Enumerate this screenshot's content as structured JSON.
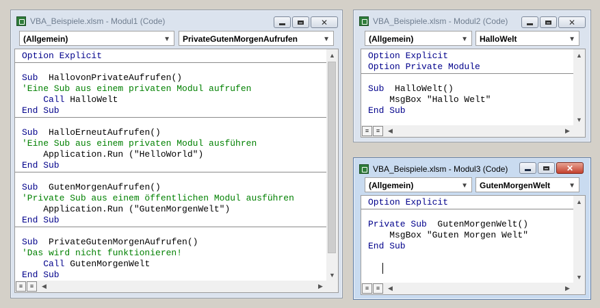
{
  "windows": [
    {
      "title": "VBA_Beispiele.xlsm - Modul1 (Code)",
      "object_combo": "(Allgemein)",
      "proc_combo": "PrivateGutenMorgenAufrufen",
      "lines": [
        "Option Explicit",
        "",
        "Sub HallovonPrivateAufrufen()",
        "'Eine Sub aus einem privaten Modul aufrufen",
        "    Call HalloWelt",
        "End Sub",
        "",
        "Sub HalloErneutAufrufen()",
        "'Eine Sub aus einem privaten Modul ausführen",
        "    Application.Run (\"HelloWorld\")",
        "End Sub",
        "",
        "Sub GutenMorgenAufrufen()",
        "'Private Sub aus einem öffentlichen Modul ausführen",
        "    Application.Run (\"GutenMorgenWelt\")",
        "End Sub",
        "",
        "Sub PrivateGutenMorgenAufrufen()",
        "'Das wird nicht funktionieren!",
        "    Call GutenMorgenWelt",
        "End Sub"
      ]
    },
    {
      "title": "VBA_Beispiele.xlsm - Modul2 (Code)",
      "object_combo": "(Allgemein)",
      "proc_combo": "HalloWelt",
      "lines": [
        "Option Explicit",
        "Option Private Module",
        "",
        "Sub HalloWelt()",
        "    MsgBox \"Hallo Welt\"",
        "End Sub"
      ]
    },
    {
      "title": "VBA_Beispiele.xlsm - Modul3 (Code)",
      "object_combo": "(Allgemein)",
      "proc_combo": "GutenMorgenWelt",
      "lines": [
        "Option Explicit",
        "",
        "Private Sub GutenMorgenWelt()",
        "    MsgBox \"Guten Morgen Welt\"",
        "End Sub"
      ]
    }
  ],
  "icons": {
    "minimize": "minimize-icon",
    "maximize": "maximize-icon",
    "close": "close-icon",
    "dropdown": "chevron-down-icon",
    "procedure_view": "procedure-view-icon",
    "module_view": "full-module-view-icon"
  },
  "colors": {
    "keyword": "#00008b",
    "comment": "#008000",
    "active_title": "#c9dbf0",
    "inactive_title": "#dbe3ee"
  }
}
